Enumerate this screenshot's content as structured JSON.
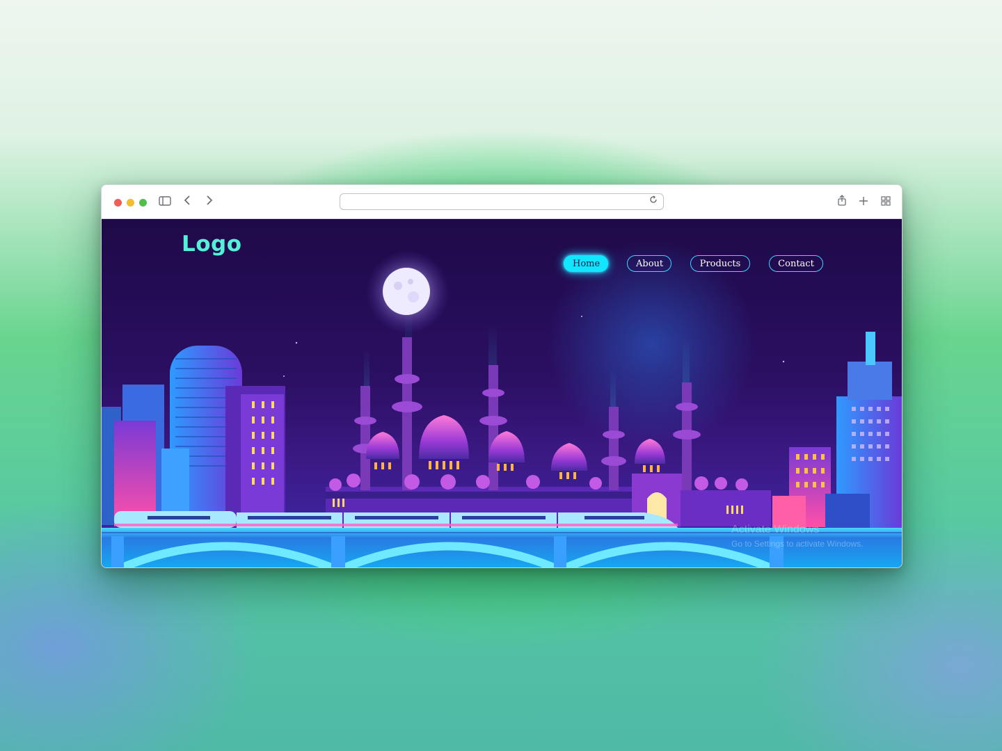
{
  "browser": {
    "traffic_lights": {
      "close": "#ee5e56",
      "minimize": "#f4bc2f",
      "maximize": "#4fc04a"
    },
    "toolbar_icons": [
      "sidebar-icon",
      "back-icon",
      "forward-icon",
      "reload-icon",
      "share-icon",
      "new-tab-icon",
      "tab-overview-icon"
    ],
    "address": {
      "value": ""
    }
  },
  "site": {
    "logo": "Logo",
    "nav": [
      {
        "label": "Home",
        "active": true
      },
      {
        "label": "About",
        "active": false
      },
      {
        "label": "Products",
        "active": false
      },
      {
        "label": "Contact",
        "active": false
      }
    ],
    "accent_color": "#12e6ff",
    "logo_color": "#55f0d8"
  },
  "os_watermark": {
    "title": "Activate Windows",
    "subtitle": "Go to Settings to activate Windows."
  }
}
